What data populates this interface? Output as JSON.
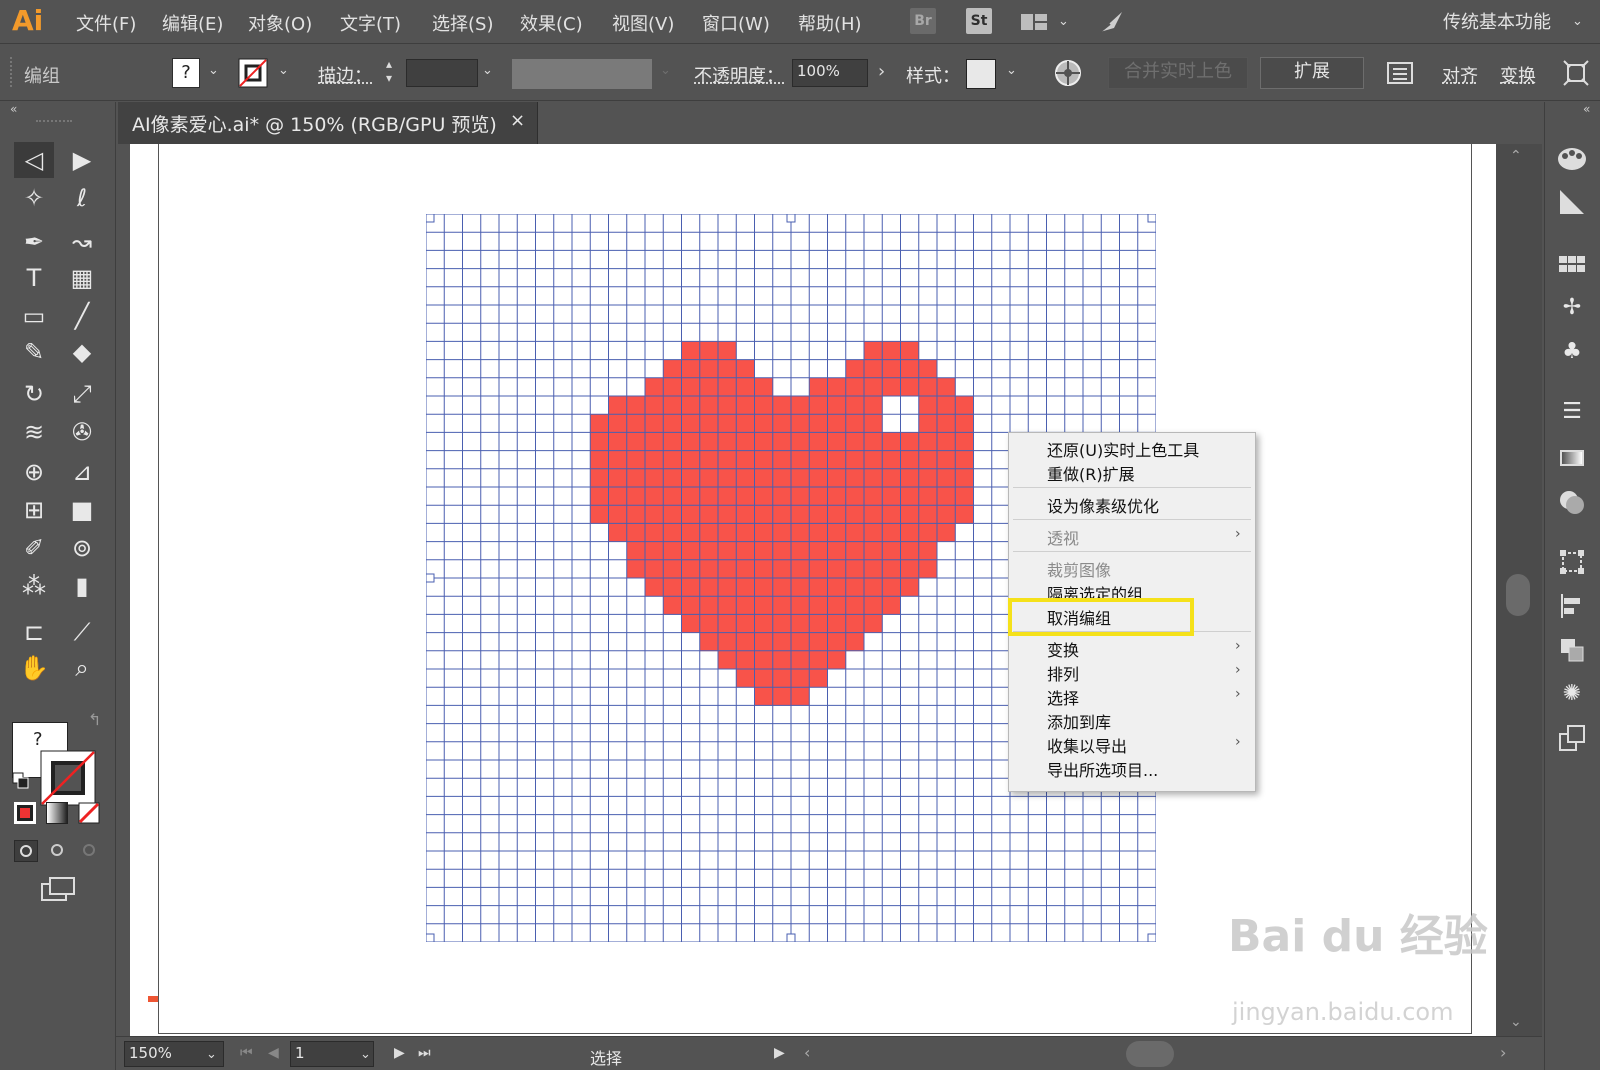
{
  "app": {
    "logo": "Ai",
    "menus": [
      "文件(F)",
      "编辑(E)",
      "对象(O)",
      "文字(T)",
      "选择(S)",
      "效果(C)",
      "视图(V)",
      "窗口(W)",
      "帮助(H)"
    ],
    "bridge_label": "Br",
    "stock_label": "St",
    "workspace": "传统基本功能"
  },
  "control": {
    "selection_label": "编组",
    "fill_value": "?",
    "stroke_label": "描边：",
    "opacity_label": "不透明度：",
    "opacity_value": "100%",
    "style_label": "样式：",
    "merge_live_paint_label": "合并实时上色",
    "expand_label": "扩展",
    "align_label": "对齐",
    "transform_label": "变换"
  },
  "document": {
    "tab_title": "AI像素爱心.ai* @ 150% (RGB/GPU 预览)",
    "close_glyph": "×"
  },
  "context_menu": {
    "items": [
      {
        "label": "还原(U)实时上色工具",
        "disabled": false,
        "submenu": false
      },
      {
        "label": "重做(R)扩展",
        "disabled": false,
        "submenu": false
      },
      {
        "label": "设为像素级优化",
        "disabled": false,
        "submenu": false
      },
      {
        "label": "透视",
        "disabled": true,
        "submenu": true
      },
      {
        "label": "裁剪图像",
        "disabled": true,
        "submenu": false
      },
      {
        "label": "隔离选定的组",
        "disabled": false,
        "submenu": false
      },
      {
        "label": "取消编组",
        "disabled": false,
        "submenu": false
      },
      {
        "label": "变换",
        "disabled": false,
        "submenu": true
      },
      {
        "label": "排列",
        "disabled": false,
        "submenu": true
      },
      {
        "label": "选择",
        "disabled": false,
        "submenu": true
      },
      {
        "label": "添加到库",
        "disabled": false,
        "submenu": false
      },
      {
        "label": "收集以导出",
        "disabled": false,
        "submenu": true
      },
      {
        "label": "导出所选项目...",
        "disabled": false,
        "submenu": false
      }
    ],
    "submenu_arrow": "›"
  },
  "status": {
    "zoom": "150%",
    "artboard_number": "1",
    "tool_name": "选择"
  },
  "watermark": {
    "brand": "Bai du 经验",
    "url": "jingyan.baidu.com"
  },
  "colors": {
    "heart": "#f8534a",
    "grid": "#4a5fb0",
    "highlight": "#f5e11a",
    "accent": "#f39a2b"
  },
  "pixel_heart": {
    "columns": 40,
    "rows": 40,
    "filled_rows": [
      {
        "row": 7,
        "spans": [
          [
            14,
            16
          ],
          [
            24,
            26
          ]
        ]
      },
      {
        "row": 8,
        "spans": [
          [
            13,
            17
          ],
          [
            23,
            27
          ]
        ]
      },
      {
        "row": 9,
        "spans": [
          [
            12,
            18
          ],
          [
            21,
            28
          ]
        ]
      },
      {
        "row": 10,
        "spans": [
          [
            10,
            24
          ],
          [
            27,
            29
          ]
        ]
      },
      {
        "row": 11,
        "spans": [
          [
            9,
            24
          ],
          [
            27,
            29
          ]
        ]
      },
      {
        "row": 12,
        "spans": [
          [
            9,
            26
          ],
          [
            27,
            29
          ]
        ]
      },
      {
        "row": 13,
        "spans": [
          [
            9,
            29
          ]
        ]
      },
      {
        "row": 14,
        "spans": [
          [
            9,
            29
          ]
        ]
      },
      {
        "row": 15,
        "spans": [
          [
            9,
            29
          ]
        ]
      },
      {
        "row": 16,
        "spans": [
          [
            9,
            29
          ]
        ]
      },
      {
        "row": 17,
        "spans": [
          [
            10,
            28
          ]
        ]
      },
      {
        "row": 18,
        "spans": [
          [
            11,
            27
          ]
        ]
      },
      {
        "row": 19,
        "spans": [
          [
            11,
            27
          ]
        ]
      },
      {
        "row": 20,
        "spans": [
          [
            12,
            26
          ]
        ]
      },
      {
        "row": 21,
        "spans": [
          [
            13,
            25
          ]
        ]
      },
      {
        "row": 22,
        "spans": [
          [
            14,
            24
          ]
        ]
      },
      {
        "row": 23,
        "spans": [
          [
            15,
            23
          ]
        ]
      },
      {
        "row": 24,
        "spans": [
          [
            16,
            22
          ]
        ]
      },
      {
        "row": 25,
        "spans": [
          [
            17,
            21
          ]
        ]
      },
      {
        "row": 26,
        "spans": [
          [
            18,
            20
          ]
        ]
      }
    ]
  }
}
